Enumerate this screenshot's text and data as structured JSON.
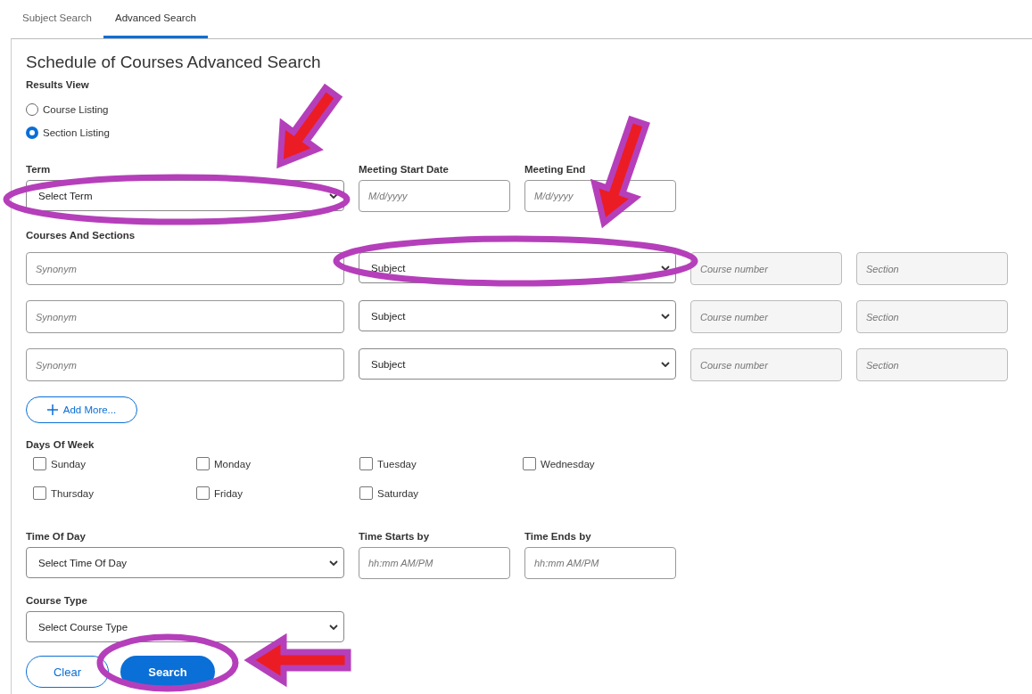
{
  "tabs": [
    {
      "label": "Subject Search",
      "selected": false
    },
    {
      "label": "Advanced Search",
      "selected": true
    }
  ],
  "title": "Schedule of Courses Advanced Search",
  "results_view": {
    "label": "Results View",
    "options": [
      {
        "label": "Course Listing",
        "selected": false
      },
      {
        "label": "Section Listing",
        "selected": true
      }
    ]
  },
  "term": {
    "label": "Term",
    "value": "Select Term"
  },
  "meeting_start": {
    "label": "Meeting Start Date",
    "placeholder": "M/d/yyyy"
  },
  "meeting_end": {
    "label": "Meeting End",
    "placeholder": "M/d/yyyy"
  },
  "courses": {
    "label": "Courses And Sections",
    "rows": [
      {
        "synonym_placeholder": "Synonym",
        "subject": "Subject",
        "course_number_placeholder": "Course number",
        "section_placeholder": "Section"
      },
      {
        "synonym_placeholder": "Synonym",
        "subject": "Subject",
        "course_number_placeholder": "Course number",
        "section_placeholder": "Section"
      },
      {
        "synonym_placeholder": "Synonym",
        "subject": "Subject",
        "course_number_placeholder": "Course number",
        "section_placeholder": "Section"
      }
    ]
  },
  "add_more": "Add More...",
  "days": {
    "label": "Days Of Week",
    "items": [
      {
        "label": "Sunday",
        "checked": false
      },
      {
        "label": "Monday",
        "checked": false
      },
      {
        "label": "Tuesday",
        "checked": false
      },
      {
        "label": "Wednesday",
        "checked": false
      },
      {
        "label": "Thursday",
        "checked": false
      },
      {
        "label": "Friday",
        "checked": false
      },
      {
        "label": "Saturday",
        "checked": false
      }
    ]
  },
  "time_of_day": {
    "label": "Time Of Day",
    "value": "Select Time Of Day"
  },
  "time_starts": {
    "label": "Time Starts by",
    "placeholder": "hh:mm AM/PM"
  },
  "time_ends": {
    "label": "Time Ends by",
    "placeholder": "hh:mm AM/PM"
  },
  "course_type": {
    "label": "Course Type",
    "value": "Select Course Type"
  },
  "buttons": {
    "clear": "Clear",
    "search": "Search"
  }
}
